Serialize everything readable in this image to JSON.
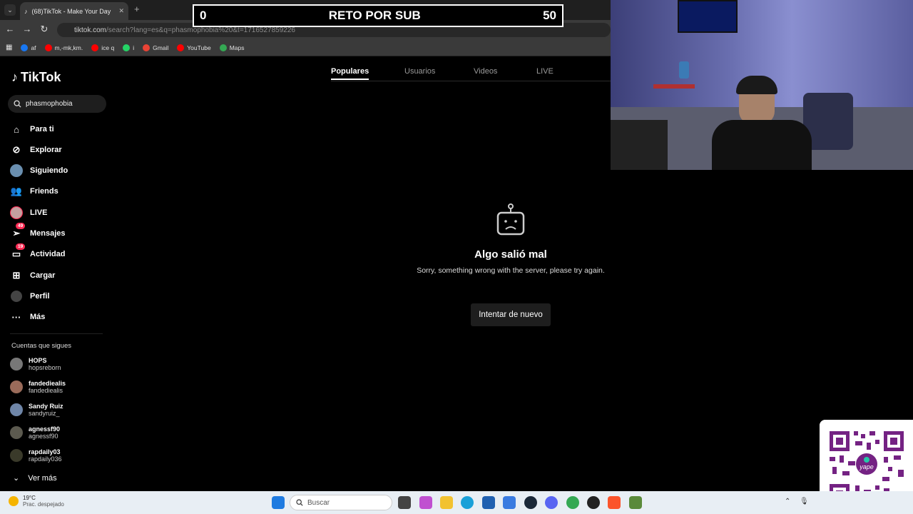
{
  "browser": {
    "tab_title": "(68)TikTok - Make Your Day",
    "url_main": "tiktok.com",
    "url_rest": "/search?lang=es&q=phasmophobia%20&t=1716527859226",
    "bookmarks": [
      "af",
      "m,-mk,km.",
      "ice q",
      "i",
      "Gmail",
      "YouTube",
      "Maps"
    ]
  },
  "overlay": {
    "left": "0",
    "title": "RETO POR SUB",
    "right": "50"
  },
  "tiktok": {
    "logo": "TikTok",
    "search_value": "phasmophobia",
    "nav": [
      {
        "label": "Para ti",
        "icon": "home-icon"
      },
      {
        "label": "Explorar",
        "icon": "compass-icon"
      },
      {
        "label": "Siguiendo",
        "icon": "avatar-icon"
      },
      {
        "label": "Friends",
        "icon": "friends-icon"
      },
      {
        "label": "LIVE",
        "icon": "live-icon"
      },
      {
        "label": "Mensajes",
        "icon": "message-icon",
        "badge": "49"
      },
      {
        "label": "Actividad",
        "icon": "activity-icon",
        "badge": "19"
      },
      {
        "label": "Cargar",
        "icon": "upload-icon"
      },
      {
        "label": "Perfil",
        "icon": "profile-icon"
      },
      {
        "label": "Más",
        "icon": "more-icon"
      }
    ],
    "following_title": "Cuentas que sigues",
    "accounts": [
      {
        "name": "HOPS",
        "handle": "hopsreborn"
      },
      {
        "name": "fandediealis",
        "handle": "fandediealis"
      },
      {
        "name": "Sandy Ruiz",
        "handle": "sandyruiz_"
      },
      {
        "name": "agnessf90",
        "handle": "agnessf90"
      },
      {
        "name": "rapdaily03",
        "handle": "rapdaily036"
      }
    ],
    "see_more": "Ver más",
    "tabs": [
      "Populares",
      "Usuarios",
      "Videos",
      "LIVE"
    ],
    "error_title": "Algo salió mal",
    "error_message": "Sorry, something wrong with the server, please try again.",
    "retry_label": "Intentar de nuevo"
  },
  "taskbar": {
    "temperature": "19°C",
    "weather": "Prac. despejado",
    "search_placeholder": "Buscar"
  },
  "colors": {
    "accent": "#fe2c55"
  }
}
